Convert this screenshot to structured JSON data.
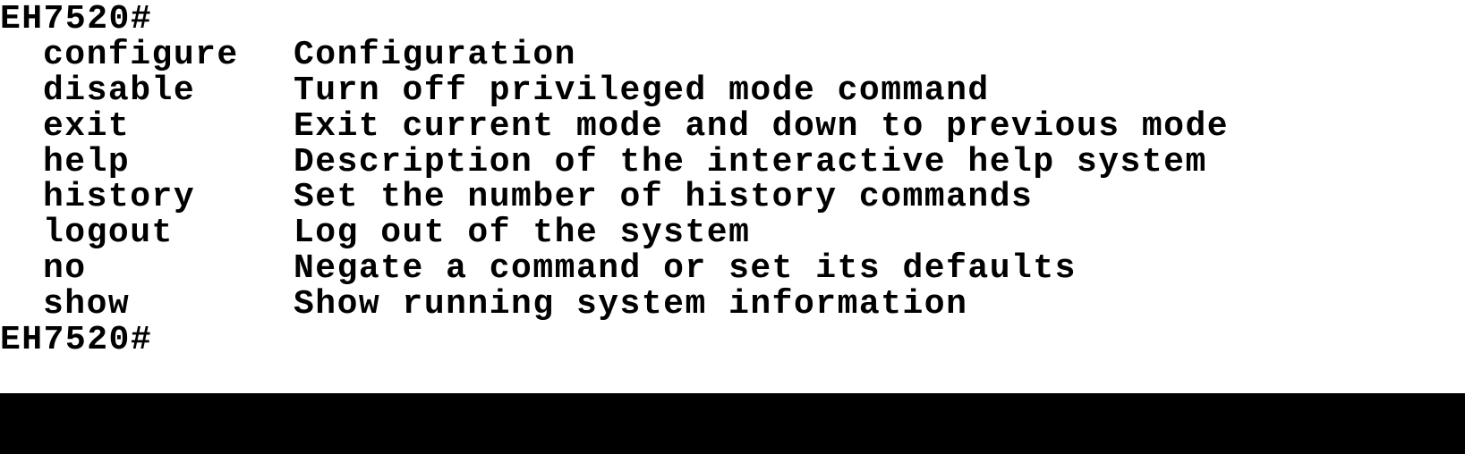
{
  "terminal": {
    "prompt_top": "EH7520#",
    "prompt_bottom": "EH7520#",
    "commands": [
      {
        "name": "configure",
        "description": "Configuration"
      },
      {
        "name": "disable",
        "description": "Turn off privileged mode command"
      },
      {
        "name": "exit",
        "description": "Exit current mode and down to previous mode"
      },
      {
        "name": "help",
        "description": "Description of the interactive help system"
      },
      {
        "name": "history",
        "description": "Set the number of history commands"
      },
      {
        "name": "logout",
        "description": "Log out of the system"
      },
      {
        "name": "no",
        "description": "Negate a command or set its defaults"
      },
      {
        "name": "show",
        "description": "Show running system information"
      }
    ]
  }
}
